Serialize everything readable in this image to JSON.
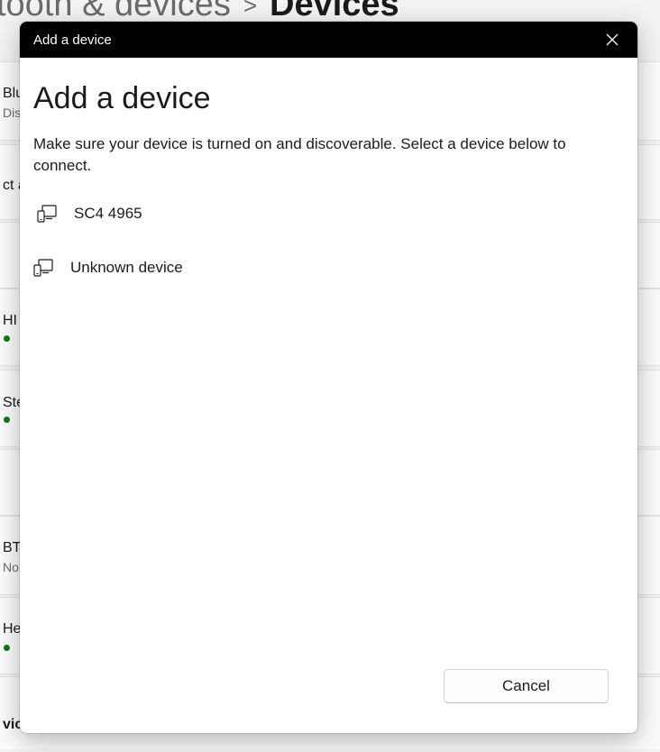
{
  "background": {
    "breadcrumb_parent": "tooth & devices",
    "breadcrumb_separator": ">",
    "breadcrumb_current": "Devices",
    "cards": [
      {
        "title": "Blu",
        "subtitle": "Dis"
      },
      {
        "title": "ct a"
      },
      {},
      {
        "title": "HI",
        "connected": true
      },
      {
        "title": "Ste",
        "connected": true
      },
      {},
      {
        "title": "BT",
        "subtitle": "No"
      },
      {
        "title": "He",
        "connected": true
      },
      {
        "title": "vic"
      }
    ]
  },
  "dialog": {
    "window_title": "Add a device",
    "heading": "Add a device",
    "instructions": "Make sure your device is turned on and discoverable. Select a device below to connect.",
    "devices": [
      {
        "label": "SC4 4965",
        "icon": "device-icon"
      },
      {
        "label": "Unknown device",
        "icon": "device-icon"
      }
    ],
    "cancel_label": "Cancel",
    "close_icon": "close-icon"
  },
  "colors": {
    "titlebar": "#000000",
    "dialog_bg": "#ffffff",
    "status_connected": "#0f7b0f"
  }
}
